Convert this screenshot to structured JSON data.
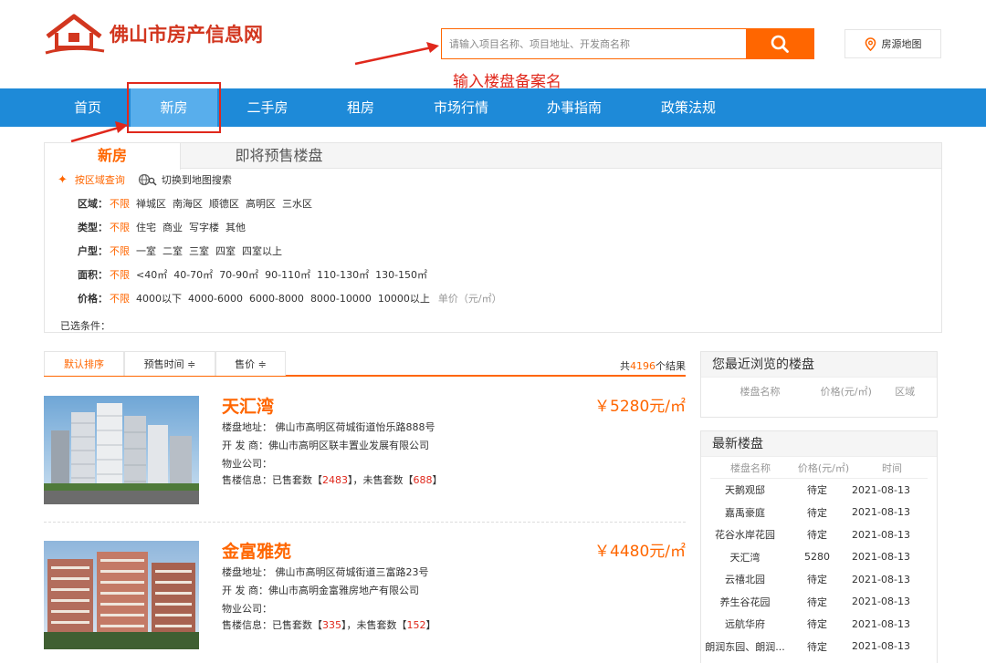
{
  "header": {
    "logo_text": "佛山市房产信息网",
    "search_placeholder": "请输入项目名称、项目地址、开发商名称",
    "map_button": "房源地图",
    "annotation": "输入楼盘备案名"
  },
  "nav": {
    "items": [
      "首页",
      "新房",
      "二手房",
      "租房",
      "市场行情",
      "办事指南",
      "政策法规"
    ],
    "active": "新房"
  },
  "filter": {
    "tabs": [
      "新房",
      "即将预售楼盘"
    ],
    "mode_area": "按区域查询",
    "mode_map": "切换到地图搜索",
    "rows": [
      {
        "label": "区域：",
        "options": [
          "不限",
          "禅城区",
          "南海区",
          "顺德区",
          "高明区",
          "三水区"
        ]
      },
      {
        "label": "类型：",
        "options": [
          "不限",
          "住宅",
          "商业",
          "写字楼",
          "其他"
        ]
      },
      {
        "label": "户型：",
        "options": [
          "不限",
          "一室",
          "二室",
          "三室",
          "四室",
          "四室以上"
        ]
      },
      {
        "label": "面积：",
        "options": [
          "不限",
          "<40㎡",
          "40-70㎡",
          "70-90㎡",
          "90-110㎡",
          "110-130㎡",
          "130-150㎡"
        ]
      },
      {
        "label": "价格：",
        "options": [
          "不限",
          "4000以下",
          "4000-6000",
          "6000-8000",
          "8000-10000",
          "10000以上"
        ],
        "unit": "单价（元/㎡）"
      }
    ],
    "selected_label": "已选条件："
  },
  "sort": {
    "options": [
      "默认排序",
      "预售时间 ≑",
      "售价 ≑"
    ],
    "total_prefix": "共",
    "total_count": "4196",
    "total_suffix": "个结果"
  },
  "listings": [
    {
      "name": "天汇湾",
      "price": "￥5280",
      "price_unit": "元/㎡",
      "address_label": "楼盘地址：",
      "address": "佛山市高明区荷城街道怡乐路888号",
      "developer_label": "开 发 商：",
      "developer": "佛山市高明区联丰置业发展有限公司",
      "property_label": "物业公司：",
      "sales_label": "售楼信息：已售套数【",
      "sold": "2483",
      "sales_mid": "】，未售套数【",
      "unsold": "688",
      "sales_end": "】"
    },
    {
      "name": "金富雅苑",
      "price": "￥4480",
      "price_unit": "元/㎡",
      "address_label": "楼盘地址：",
      "address": "佛山市高明区荷城街道三富路23号",
      "developer_label": "开 发 商：",
      "developer": "佛山市高明金富雅房地产有限公司",
      "property_label": "物业公司：",
      "sales_label": "售楼信息：已售套数【",
      "sold": "335",
      "sales_mid": "】，未售套数【",
      "unsold": "152",
      "sales_end": "】"
    }
  ],
  "sidebar": {
    "recent": {
      "title": "您最近浏览的楼盘",
      "headers": [
        "楼盘名称",
        "价格(元/㎡)",
        "区域"
      ]
    },
    "latest": {
      "title": "最新楼盘",
      "headers": [
        "楼盘名称",
        "价格(元/㎡)",
        "时间"
      ],
      "rows": [
        [
          "天鹅观邸",
          "待定",
          "2021-08-13"
        ],
        [
          "嘉禹豪庭",
          "待定",
          "2021-08-13"
        ],
        [
          "花谷水岸花园",
          "待定",
          "2021-08-13"
        ],
        [
          "天汇湾",
          "5280",
          "2021-08-13"
        ],
        [
          "云禧北园",
          "待定",
          "2021-08-13"
        ],
        [
          "养生谷花园",
          "待定",
          "2021-08-13"
        ],
        [
          "远航华府",
          "待定",
          "2021-08-13"
        ],
        [
          "朗润东园、朗润...",
          "待定",
          "2021-08-13"
        ]
      ]
    }
  },
  "colors": {
    "accent": "#ff6600",
    "nav": "#1e8ad8",
    "nav_active": "#58aeec",
    "annotation": "#e0281c"
  }
}
